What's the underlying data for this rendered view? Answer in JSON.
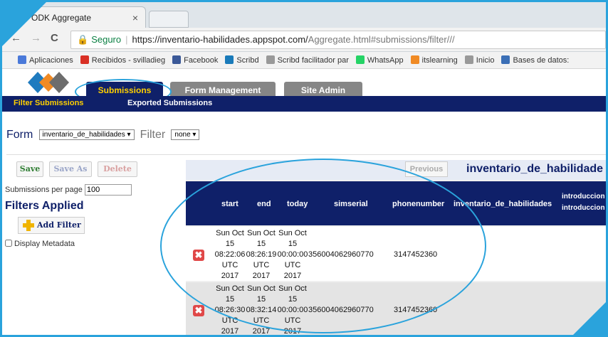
{
  "browser": {
    "tab_title": "ODK Aggregate",
    "tab_close": "×",
    "url_secure_label": "Seguro",
    "url_host": "https://inventario-habilidades.appspot.com/",
    "url_path": "Aggregate.html#submissions/filter///",
    "nav_back": "←",
    "nav_forward": "→",
    "nav_reload": "C",
    "lock_icon": "🔒"
  },
  "bookmarks": [
    {
      "label": "Aplicaciones",
      "color": "#4a79d9"
    },
    {
      "label": "Recibidos - svilladieg",
      "color": "#d93025"
    },
    {
      "label": "Facebook",
      "color": "#3b5998"
    },
    {
      "label": "Scribd",
      "color": "#1a7bba"
    },
    {
      "label": "Scribd facilitador par",
      "color": "#999999"
    },
    {
      "label": "WhatsApp",
      "color": "#25d366"
    },
    {
      "label": "itslearning",
      "color": "#f08a24"
    },
    {
      "label": "Inicio",
      "color": "#999999"
    },
    {
      "label": "Bases de datos:",
      "color": "#3b6fb6"
    }
  ],
  "app": {
    "tabs": {
      "submissions": "Submissions",
      "form_management": "Form Management",
      "site_admin": "Site Admin"
    },
    "subnav": {
      "filter": "Filter Submissions",
      "exported": "Exported Submissions"
    },
    "form_label": "Form",
    "form_value": "inventario_de_habilidades ▾",
    "filter_label": "Filter",
    "filter_value": "none ▾"
  },
  "left": {
    "save": "Save",
    "save_as": "Save As",
    "delete": "Delete",
    "per_page_label": "Submissions per page",
    "per_page_value": "100",
    "filters_title": "Filters Applied",
    "add_filter": "Add Filter",
    "display_metadata": "Display Metadata"
  },
  "table": {
    "previous": "Previous",
    "form_title": "inventario_de_habilidade",
    "headers": {
      "start": "start",
      "end": "end",
      "today": "today",
      "simserial": "simserial",
      "phonenumber": "phonenumber",
      "inventario": "inventario_de_habilidades",
      "intro1": "introduccion",
      "intro2": "introduccion"
    },
    "rows": [
      {
        "start": [
          "Sun Oct",
          "15",
          "08:22:06",
          "UTC",
          "2017"
        ],
        "end": [
          "Sun Oct",
          "15",
          "08:26:19",
          "UTC",
          "2017"
        ],
        "today": [
          "Sun Oct",
          "15",
          "00:00:00",
          "UTC",
          "2017"
        ],
        "simserial": "356004062960770",
        "phonenumber": "3147452360"
      },
      {
        "start": [
          "Sun Oct",
          "15",
          "08:26:30",
          "UTC",
          "2017"
        ],
        "end": [
          "Sun Oct",
          "15",
          "08:32:14",
          "UTC",
          "2017"
        ],
        "today": [
          "Sun Oct",
          "15",
          "00:00:00",
          "UTC",
          "2017"
        ],
        "simserial": "356004062960770",
        "phonenumber": "3147452360"
      }
    ]
  }
}
